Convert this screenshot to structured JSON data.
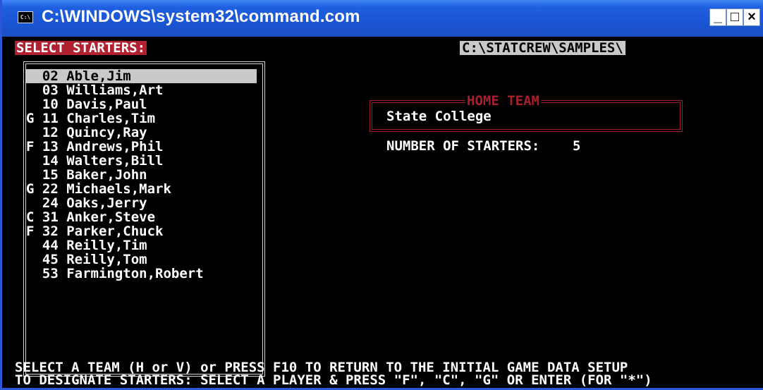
{
  "window": {
    "title": "C:\\WINDOWS\\system32\\command.com",
    "icon_text": "C:\\",
    "buttons": {
      "minimize": "_",
      "restore": "□",
      "close": "×"
    }
  },
  "console": {
    "header_left": "SELECT STARTERS:",
    "header_path": "C:\\STATCREW\\SAMPLES\\",
    "player_list": [
      {
        "text": "  02 Able,Jim",
        "selected": true
      },
      {
        "text": "  03 Williams,Art"
      },
      {
        "text": "  10 Davis,Paul"
      },
      {
        "text": "G 11 Charles,Tim"
      },
      {
        "text": "  12 Quincy,Ray"
      },
      {
        "text": "F 13 Andrews,Phil"
      },
      {
        "text": "  14 Walters,Bill"
      },
      {
        "text": "  15 Baker,John"
      },
      {
        "text": "G 22 Michaels,Mark"
      },
      {
        "text": "  24 Oaks,Jerry"
      },
      {
        "text": "C 31 Anker,Steve"
      },
      {
        "text": "F 32 Parker,Chuck"
      },
      {
        "text": "  44 Reilly,Tim"
      },
      {
        "text": "  45 Reilly,Tom"
      },
      {
        "text": "  53 Farmington,Robert"
      }
    ],
    "home_team_label": "HOME TEAM",
    "home_team_value": "State College",
    "starters_label": "NUMBER OF STARTERS:",
    "starters_value": "5",
    "instructions": [
      "SELECT A TEAM (H or V) or PRESS F10 TO RETURN TO THE INITIAL GAME DATA SETUP",
      "TO DESIGNATE STARTERS: SELECT A PLAYER & PRESS \"F\", \"C\", \"G\" OR ENTER (FOR \"*\")"
    ]
  },
  "colors": {
    "title_bar": "#1a55d4",
    "console_bg": "#000000",
    "header_highlight": "#b2212f",
    "path_highlight": "#c8c8c8",
    "selection": "#c9c9c9",
    "home_team_frame": "#9e1a27"
  }
}
